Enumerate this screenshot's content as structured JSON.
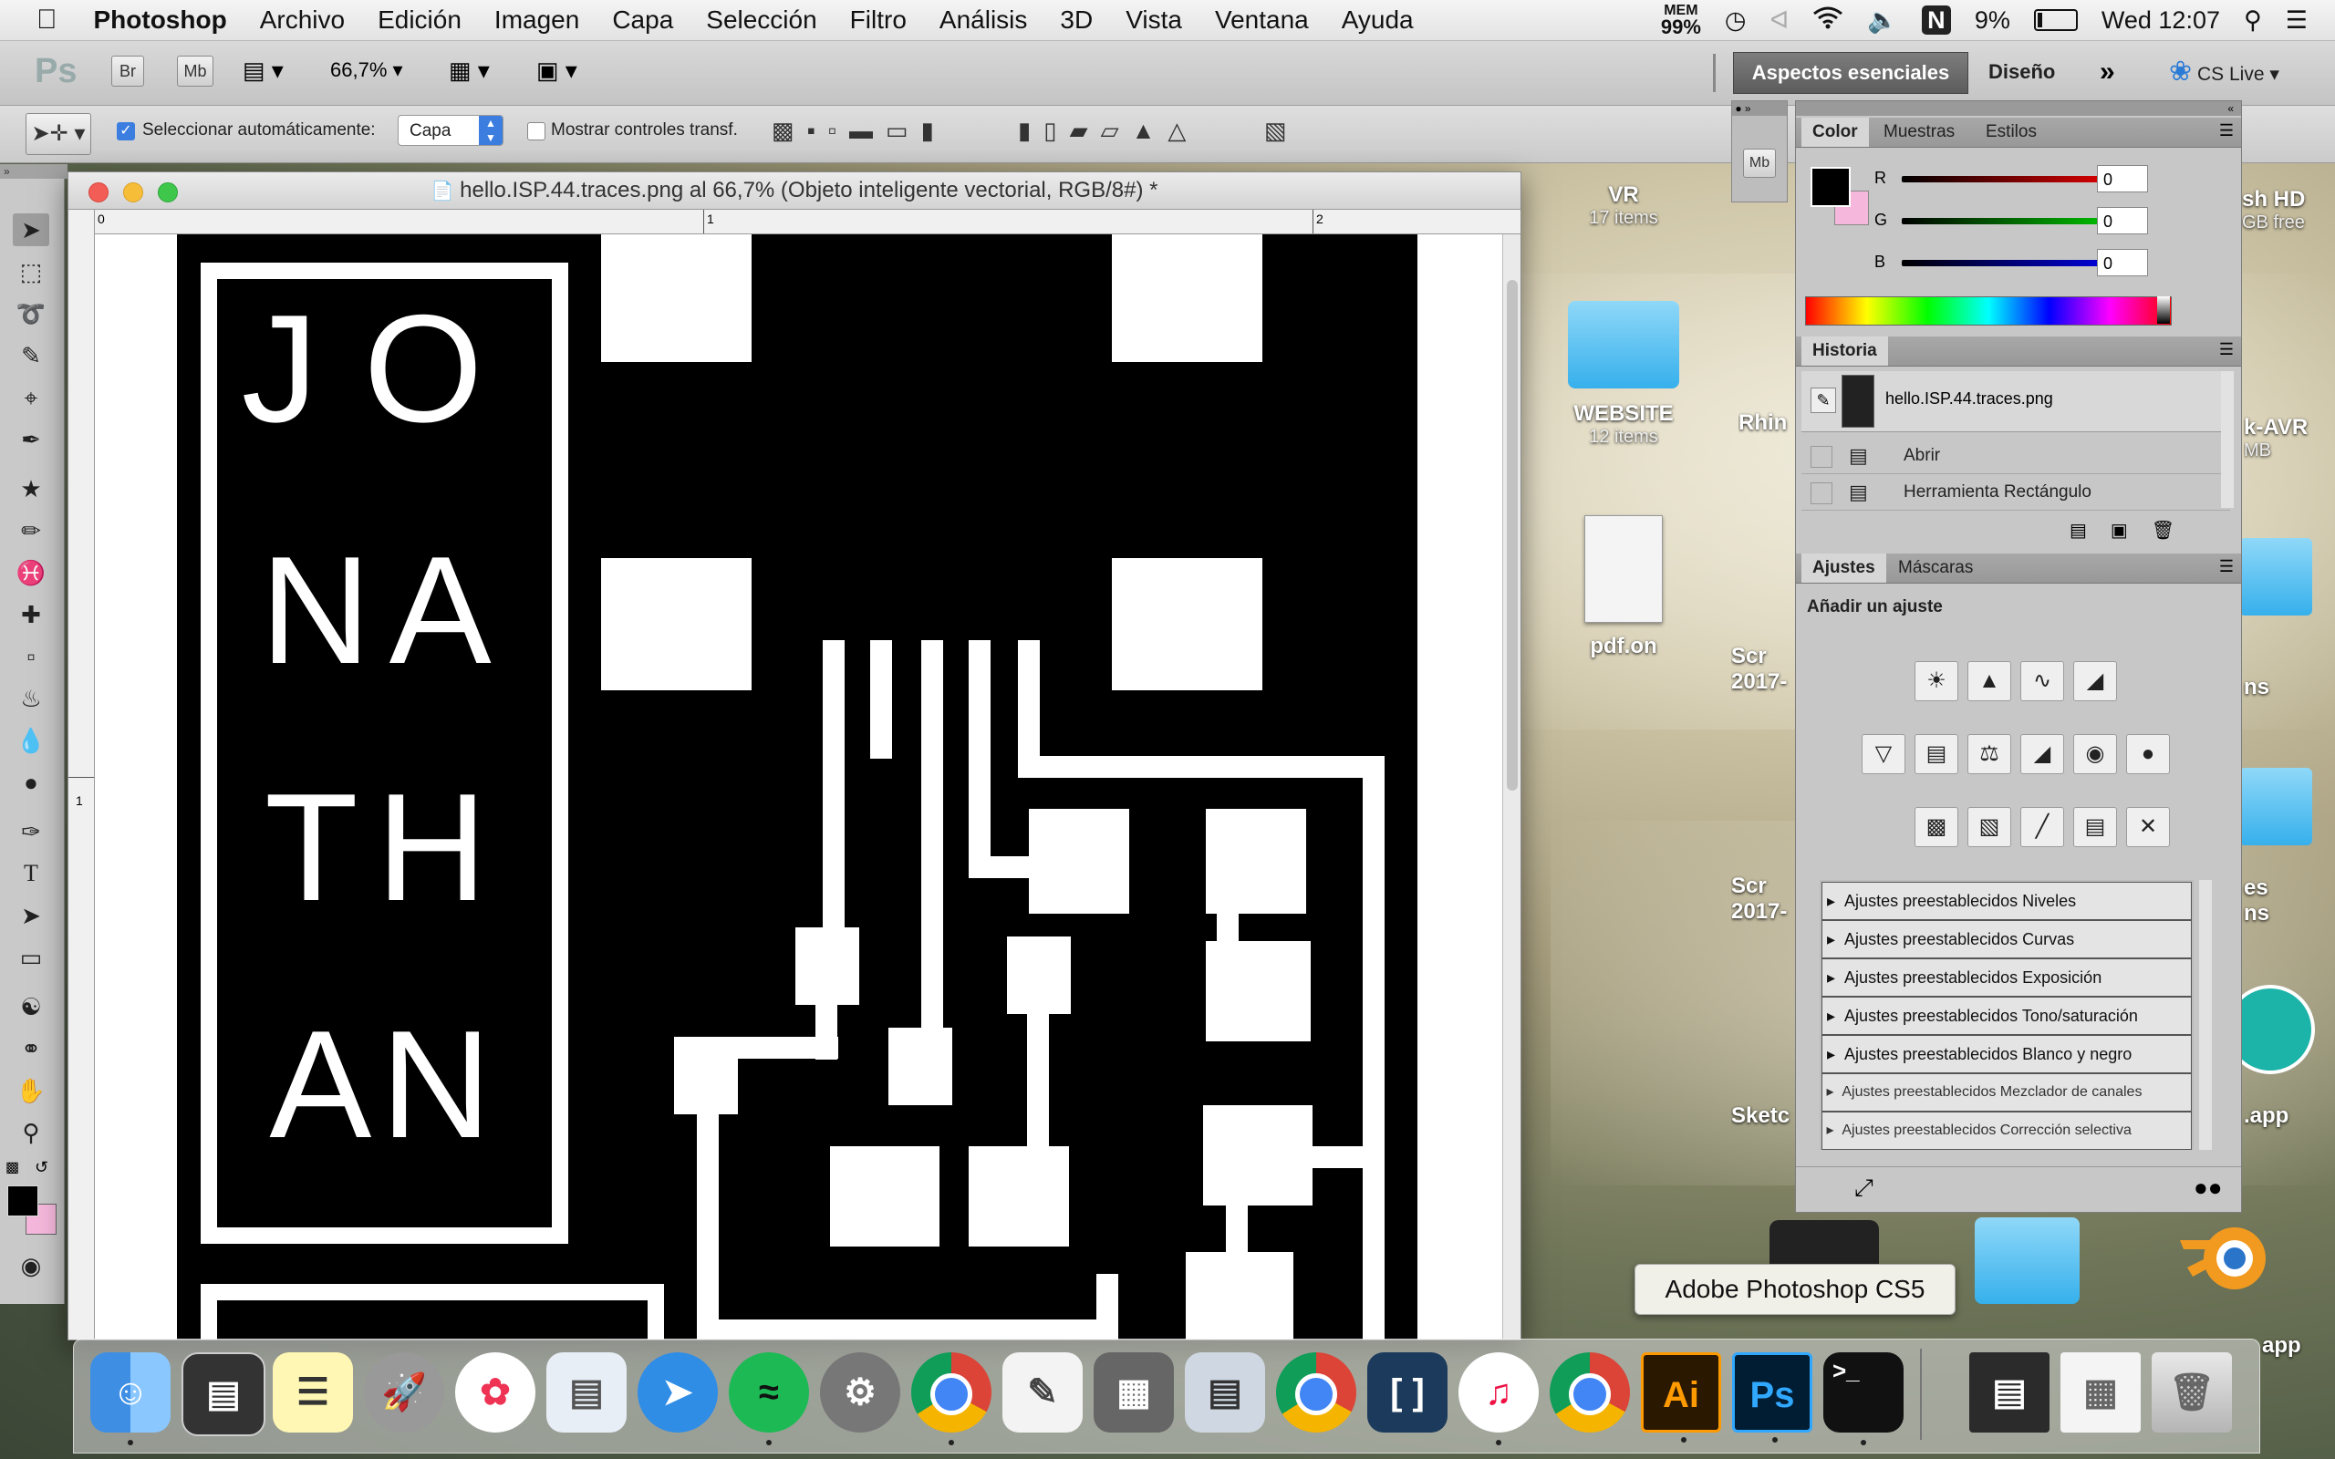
{
  "menubar": {
    "app_name": "Photoshop",
    "items": [
      "Archivo",
      "Edición",
      "Imagen",
      "Capa",
      "Selección",
      "Filtro",
      "Análisis",
      "3D",
      "Vista",
      "Ventana",
      "Ayuda"
    ],
    "mem_label": "MEM",
    "mem_value": "99%",
    "battery": "9%",
    "clock": "Wed 12:07"
  },
  "appbar": {
    "ps_logo": "Ps",
    "br": "Br",
    "mb": "Mb",
    "zoom": "66,7%",
    "workspace_active": "Aspectos esenciales",
    "workspace_other": "Diseño",
    "cs_live": "CS Live"
  },
  "options": {
    "auto_select_label": "Seleccionar automáticamente:",
    "auto_select_value": "Capa",
    "show_transform_label": "Mostrar controles transf."
  },
  "document": {
    "title": "hello.ISP.44.traces.png al 66,7% (Objeto inteligente vectorial, RGB/8#) *",
    "ruler_h": [
      "0",
      "1",
      "2"
    ],
    "ruler_v": [
      "1"
    ],
    "letters": [
      "J",
      "O",
      "N",
      "A",
      "T",
      "H",
      "A",
      "N"
    ]
  },
  "color_panel": {
    "tabs": [
      "Color",
      "Muestras",
      "Estilos"
    ],
    "r_label": "R",
    "g_label": "G",
    "b_label": "B",
    "r": "0",
    "g": "0",
    "b": "0",
    "fg_color": "#000000",
    "bg_color": "#f5b8dc"
  },
  "history_panel": {
    "tab": "Historia",
    "snapshot": "hello.ISP.44.traces.png",
    "steps": [
      "Abrir",
      "Herramienta Rectángulo"
    ]
  },
  "adjust_panel": {
    "tabs": [
      "Ajustes",
      "Máscaras"
    ],
    "heading": "Añadir un ajuste",
    "presets": [
      "Ajustes preestablecidos Niveles",
      "Ajustes preestablecidos Curvas",
      "Ajustes preestablecidos Exposición",
      "Ajustes preestablecidos Tono/saturación",
      "Ajustes preestablecidos Blanco y negro",
      "Ajustes preestablecidos Mezclador de canales",
      "Ajustes preestablecidos Corrección selectiva"
    ]
  },
  "desktop": {
    "icons": [
      {
        "label": "VR",
        "sub": "17 items"
      },
      {
        "label": "WEBSITE",
        "sub": "12 items"
      },
      {
        "label": "pdf.on",
        "sub": ""
      },
      {
        "label": "Rhin",
        "sub": ""
      },
      {
        "label": "Scr",
        "sub": "2017-"
      },
      {
        "label": "Scr",
        "sub": "2017-"
      },
      {
        "label": "Sketc",
        "sub": ""
      },
      {
        "label": "sh HD",
        "sub": "GB free"
      },
      {
        "label": "k-AVR",
        "sub": "MB"
      },
      {
        "label": "ns",
        "sub": ""
      },
      {
        "label": "es",
        "sub": "ns"
      },
      {
        "label": ".app",
        "sub": ""
      },
      {
        "label": "app",
        "sub": ""
      }
    ]
  },
  "tooltip": "Adobe Photoshop CS5",
  "dock": {
    "icons": [
      "Finder",
      "Activity",
      "Notes",
      "Launchpad",
      "Photos",
      "Preview",
      "Safari",
      "Spotify",
      "System Preferences",
      "Chrome",
      "TextEdit",
      "Calculator",
      "Migration",
      "Chrome",
      "Brackets",
      "iTunes",
      "Chrome",
      "Illustrator",
      "Photoshop",
      "Terminal",
      "Screenshot",
      "Screenshot 2",
      "Trash"
    ],
    "ai_label": "Ai",
    "ps_label": "Ps",
    "terminal_label": ">_"
  }
}
